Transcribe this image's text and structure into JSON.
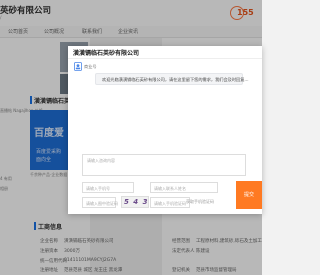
{
  "background": {
    "company_name": "英砂有限公司",
    "company_sub": "/",
    "phone": "155",
    "nav": [
      "公司首页",
      "公司概况",
      "联系我们",
      "企业资讯"
    ],
    "section_title": "潢潢镉临石英砂有限公司",
    "promo_line1": "百度爱",
    "promo_line2": "百度爱采购",
    "promo_line3": "面向全",
    "promo_caption": "千余种产品·企业数据",
    "left_items": [
      "直播帖 Nagajlhon 价格",
      "4 有用",
      "相册"
    ],
    "info_title": "工商信息",
    "info_rows": [
      {
        "label": "企业名称",
        "value": "潢潢镉临石英砂有限公司",
        "label2": "经营范围",
        "value2": "工程原材料,建筑砂,砾石及土加工"
      },
      {
        "label": "注册资本",
        "value": "3000万",
        "label2": "法定代表人",
        "value2": "陈建设"
      },
      {
        "label": "统一信用代码",
        "value": "91411101MA9CYJ2G7A",
        "label2": "",
        "value2": ""
      },
      {
        "label": "注册地址",
        "value": "范县范县 城区 龙王庄 黑龙潭",
        "label2": "登记机关",
        "value2": "范县市场监督管理局"
      }
    ]
  },
  "dialog": {
    "title": "潢潢镉临石英砂有限公司",
    "agent_name": "商业号",
    "greeting": "欢迎光临潢潢镉临石英砂有限公司，请在这里留下您的需求，我们会及时回复…",
    "message_placeholder": "请输入咨询内容",
    "phone_placeholder": "请输入手机号",
    "contact_placeholder": "请输入联系人姓名",
    "code_placeholder": "请输入图中验证码",
    "sms_placeholder": "请输入手机验证码",
    "captcha_text": "5 4 3",
    "refresh_label": "获取手机验证码",
    "submit_label": "提交"
  },
  "colors": {
    "accent": "#ff7a22",
    "brand_blue": "#1e6fd9"
  }
}
